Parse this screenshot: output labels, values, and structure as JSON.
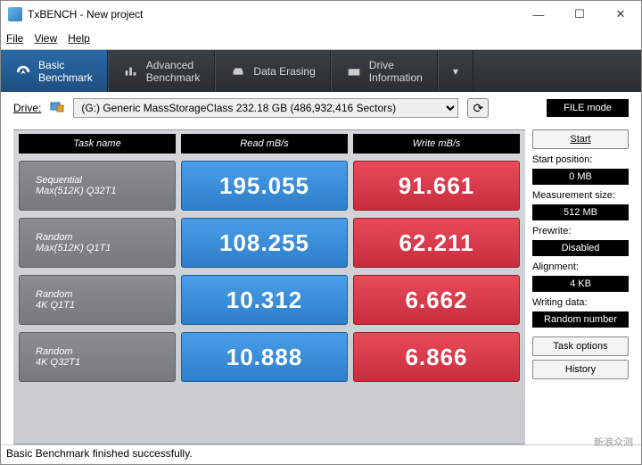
{
  "window": {
    "title": "TxBENCH - New project"
  },
  "menu": {
    "file": "File",
    "view": "View",
    "help": "Help"
  },
  "tabs": [
    {
      "label": "Basic\nBenchmark"
    },
    {
      "label": "Advanced\nBenchmark"
    },
    {
      "label": "Data Erasing"
    },
    {
      "label": "Drive\nInformation"
    }
  ],
  "drive": {
    "label": "Drive:",
    "value": "(G:) Generic MassStorageClass  232.18 GB (486,932,416 Sectors)",
    "filemode": "FILE mode"
  },
  "headers": {
    "task": "Task name",
    "read": "Read mB/s",
    "write": "Write mB/s"
  },
  "rows": [
    {
      "name": "Sequential",
      "sub": "Max(512K) Q32T1",
      "read": "195.055",
      "write": "91.661"
    },
    {
      "name": "Random",
      "sub": "Max(512K) Q1T1",
      "read": "108.255",
      "write": "62.211"
    },
    {
      "name": "Random",
      "sub": "4K Q1T1",
      "read": "10.312",
      "write": "6.662"
    },
    {
      "name": "Random",
      "sub": "4K Q32T1",
      "read": "10.888",
      "write": "6.866"
    }
  ],
  "side": {
    "start": "Start",
    "startpos_label": "Start position:",
    "startpos": "0 MB",
    "meas_label": "Measurement size:",
    "meas": "512 MB",
    "prewrite_label": "Prewrite:",
    "prewrite": "Disabled",
    "align_label": "Alignment:",
    "align": "4 KB",
    "wdata_label": "Writing data:",
    "wdata": "Random number",
    "taskopt": "Task options",
    "history": "History"
  },
  "status": "Basic Benchmark finished successfully.",
  "watermark": "新浪众测"
}
